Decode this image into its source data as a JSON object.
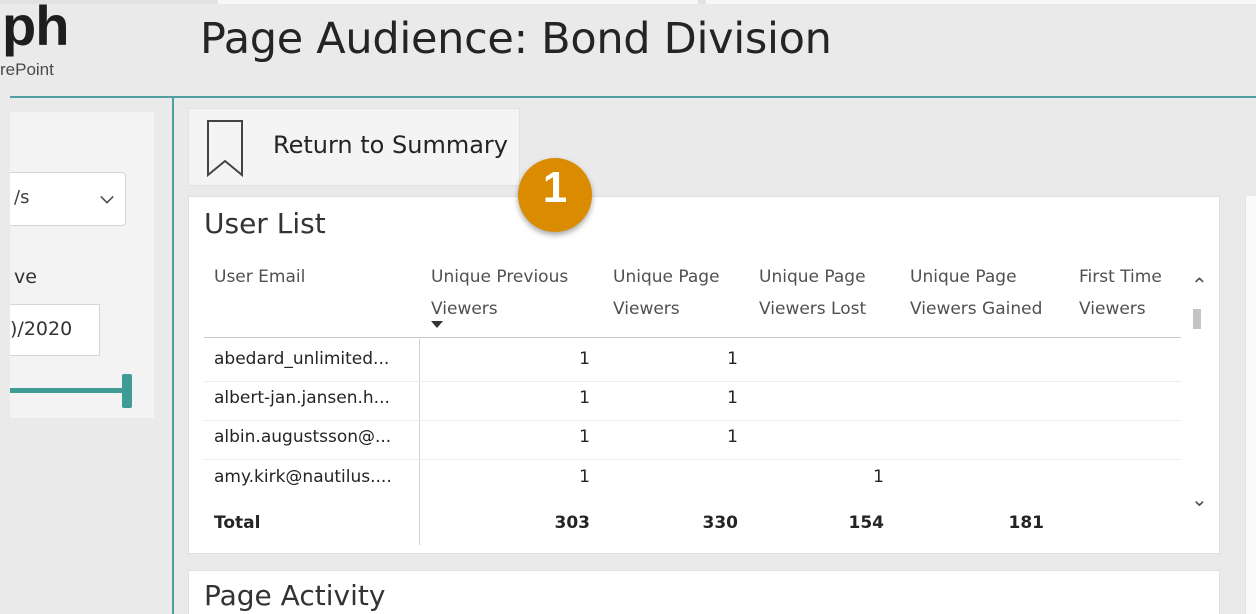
{
  "header": {
    "logo_big": "ph",
    "logo_small": "rePoint",
    "title": "Page Audience: Bond Division"
  },
  "filters": {
    "dropdown_value": "/s",
    "date_label": "ve",
    "date_value": ")/2020"
  },
  "bookmark": {
    "label": "Return to Summary"
  },
  "badge": {
    "number": "1",
    "color": "#da8b00"
  },
  "user_list": {
    "title": "User List",
    "columns": [
      {
        "label": "User Email"
      },
      {
        "label": "Unique Previous Viewers"
      },
      {
        "label": "Unique Page Viewers"
      },
      {
        "label": "Unique Page Viewers Lost"
      },
      {
        "label": "Unique Page Viewers Gained"
      },
      {
        "label": "First Time Viewers"
      }
    ],
    "sorted_column": "Unique Previous Viewers",
    "rows": [
      {
        "email": "abedard_unlimited...",
        "prev": "1",
        "page": "1",
        "lost": "",
        "gained": "",
        "first": ""
      },
      {
        "email": "albert-jan.jansen.h...",
        "prev": "1",
        "page": "1",
        "lost": "",
        "gained": "",
        "first": ""
      },
      {
        "email": "albin.augustsson@...",
        "prev": "1",
        "page": "1",
        "lost": "",
        "gained": "",
        "first": ""
      },
      {
        "email": "amy.kirk@nautilus....",
        "prev": "1",
        "page": "",
        "lost": "1",
        "gained": "",
        "first": ""
      }
    ],
    "total": {
      "label": "Total",
      "prev": "303",
      "page": "330",
      "lost": "154",
      "gained": "181",
      "first": ""
    }
  },
  "page_activity": {
    "title": "Page Activity"
  },
  "colors": {
    "accent": "#3f9b96",
    "header_line": "#4f9fa0"
  },
  "icons": {
    "bookmark": "bookmark-icon",
    "dropdown": "chevron-down-icon",
    "scroll_up": "chevron-up-icon",
    "scroll_down": "chevron-down-icon"
  }
}
